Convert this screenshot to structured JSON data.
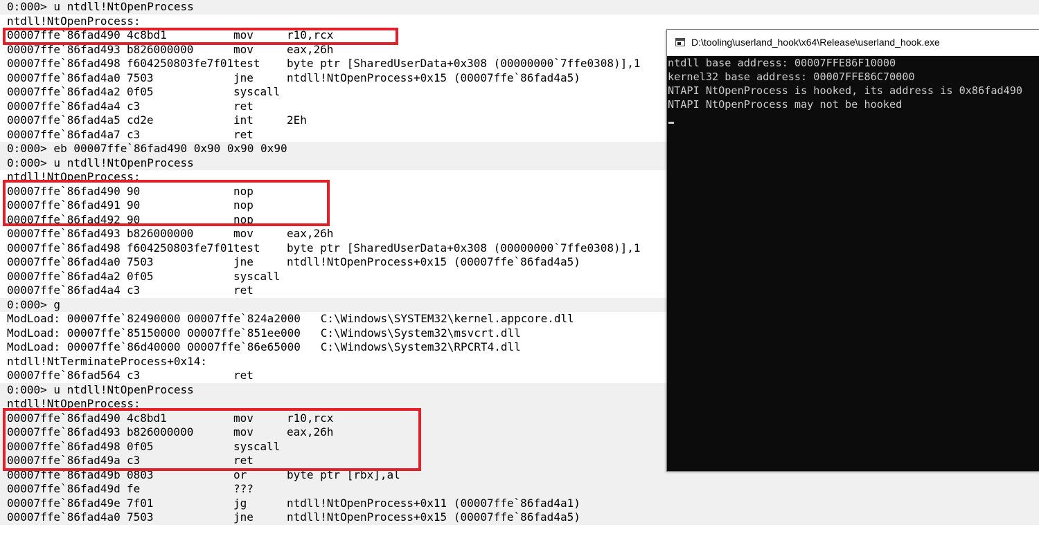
{
  "debugger": {
    "lines": [
      {
        "kind": "cmd",
        "text": "0:000> u ntdll!NtOpenProcess"
      },
      {
        "kind": "label",
        "text": "ntdll!NtOpenProcess:"
      },
      {
        "kind": "asm",
        "addr": "00007ffe`86fad490",
        "bytes": "4c8bd1",
        "mnemonic": "mov",
        "operands": "r10,rcx"
      },
      {
        "kind": "asm",
        "addr": "00007ffe`86fad493",
        "bytes": "b826000000",
        "mnemonic": "mov",
        "operands": "eax,26h"
      },
      {
        "kind": "asm",
        "addr": "00007ffe`86fad498",
        "bytes": "f604250803fe7f01",
        "mnemonic": "test",
        "operands": "byte ptr [SharedUserData+0x308 (00000000`7ffe0308)],1"
      },
      {
        "kind": "asm",
        "addr": "00007ffe`86fad4a0",
        "bytes": "7503",
        "mnemonic": "jne",
        "operands": "ntdll!NtOpenProcess+0x15 (00007ffe`86fad4a5)"
      },
      {
        "kind": "asm",
        "addr": "00007ffe`86fad4a2",
        "bytes": "0f05",
        "mnemonic": "syscall",
        "operands": ""
      },
      {
        "kind": "asm",
        "addr": "00007ffe`86fad4a4",
        "bytes": "c3",
        "mnemonic": "ret",
        "operands": ""
      },
      {
        "kind": "asm",
        "addr": "00007ffe`86fad4a5",
        "bytes": "cd2e",
        "mnemonic": "int",
        "operands": "2Eh"
      },
      {
        "kind": "asm",
        "addr": "00007ffe`86fad4a7",
        "bytes": "c3",
        "mnemonic": "ret",
        "operands": ""
      },
      {
        "kind": "cmd",
        "text": "0:000> eb 00007ffe`86fad490 0x90 0x90 0x90"
      },
      {
        "kind": "cmd",
        "text": "0:000> u ntdll!NtOpenProcess"
      },
      {
        "kind": "label",
        "text": "ntdll!NtOpenProcess:"
      },
      {
        "kind": "asm",
        "addr": "00007ffe`86fad490",
        "bytes": "90",
        "mnemonic": "nop",
        "operands": ""
      },
      {
        "kind": "asm",
        "addr": "00007ffe`86fad491",
        "bytes": "90",
        "mnemonic": "nop",
        "operands": ""
      },
      {
        "kind": "asm",
        "addr": "00007ffe`86fad492",
        "bytes": "90",
        "mnemonic": "nop",
        "operands": ""
      },
      {
        "kind": "asm",
        "addr": "00007ffe`86fad493",
        "bytes": "b826000000",
        "mnemonic": "mov",
        "operands": "eax,26h"
      },
      {
        "kind": "asm",
        "addr": "00007ffe`86fad498",
        "bytes": "f604250803fe7f01",
        "mnemonic": "test",
        "operands": "byte ptr [SharedUserData+0x308 (00000000`7ffe0308)],1"
      },
      {
        "kind": "asm",
        "addr": "00007ffe`86fad4a0",
        "bytes": "7503",
        "mnemonic": "jne",
        "operands": "ntdll!NtOpenProcess+0x15 (00007ffe`86fad4a5)"
      },
      {
        "kind": "asm",
        "addr": "00007ffe`86fad4a2",
        "bytes": "0f05",
        "mnemonic": "syscall",
        "operands": ""
      },
      {
        "kind": "asm",
        "addr": "00007ffe`86fad4a4",
        "bytes": "c3",
        "mnemonic": "ret",
        "operands": ""
      },
      {
        "kind": "cmd",
        "text": "0:000> g"
      },
      {
        "kind": "text",
        "text": "ModLoad: 00007ffe`82490000 00007ffe`824a2000   C:\\Windows\\SYSTEM32\\kernel.appcore.dll"
      },
      {
        "kind": "text",
        "text": "ModLoad: 00007ffe`85150000 00007ffe`851ee000   C:\\Windows\\System32\\msvcrt.dll"
      },
      {
        "kind": "text",
        "text": "ModLoad: 00007ffe`86d40000 00007ffe`86e65000   C:\\Windows\\System32\\RPCRT4.dll"
      },
      {
        "kind": "label",
        "text": "ntdll!NtTerminateProcess+0x14:"
      },
      {
        "kind": "asm",
        "addr": "00007ffe`86fad564",
        "bytes": "c3",
        "mnemonic": "ret",
        "operands": ""
      },
      {
        "kind": "cmd",
        "text": "0:000> u ntdll!NtOpenProcess"
      },
      {
        "kind": "label-gray",
        "text": "ntdll!NtOpenProcess:"
      },
      {
        "kind": "asm-gray",
        "addr": "00007ffe`86fad490",
        "bytes": "4c8bd1",
        "mnemonic": "mov",
        "operands": "r10,rcx"
      },
      {
        "kind": "asm-gray",
        "addr": "00007ffe`86fad493",
        "bytes": "b826000000",
        "mnemonic": "mov",
        "operands": "eax,26h"
      },
      {
        "kind": "asm-gray",
        "addr": "00007ffe`86fad498",
        "bytes": "0f05",
        "mnemonic": "syscall",
        "operands": ""
      },
      {
        "kind": "asm-gray",
        "addr": "00007ffe`86fad49a",
        "bytes": "c3",
        "mnemonic": "ret",
        "operands": ""
      },
      {
        "kind": "asm-gray",
        "addr": "00007ffe`86fad49b",
        "bytes": "0803",
        "mnemonic": "or",
        "operands": "byte ptr [rbx],al"
      },
      {
        "kind": "asm-gray",
        "addr": "00007ffe`86fad49d",
        "bytes": "fe",
        "mnemonic": "???",
        "operands": ""
      },
      {
        "kind": "asm-gray",
        "addr": "00007ffe`86fad49e",
        "bytes": "7f01",
        "mnemonic": "jg",
        "operands": "ntdll!NtOpenProcess+0x11 (00007ffe`86fad4a1)"
      },
      {
        "kind": "asm-gray",
        "addr": "00007ffe`86fad4a0",
        "bytes": "7503",
        "mnemonic": "jne",
        "operands": "ntdll!NtOpenProcess+0x15 (00007ffe`86fad4a5)"
      }
    ]
  },
  "console": {
    "title": "D:\\tooling\\userland_hook\\x64\\Release\\userland_hook.exe",
    "lines": [
      "ntdll base address: 00007FFE86F10000",
      "kernel32 base address: 00007FFE86C70000",
      "NTAPI NtOpenProcess is hooked, its address is 0x86fad490",
      "NTAPI NtOpenProcess may not be hooked"
    ]
  },
  "colors": {
    "highlight": "#e0202a",
    "command_band": "#f0f0f0",
    "console_background": "#0c0c0c",
    "console_text": "#cccccc"
  }
}
